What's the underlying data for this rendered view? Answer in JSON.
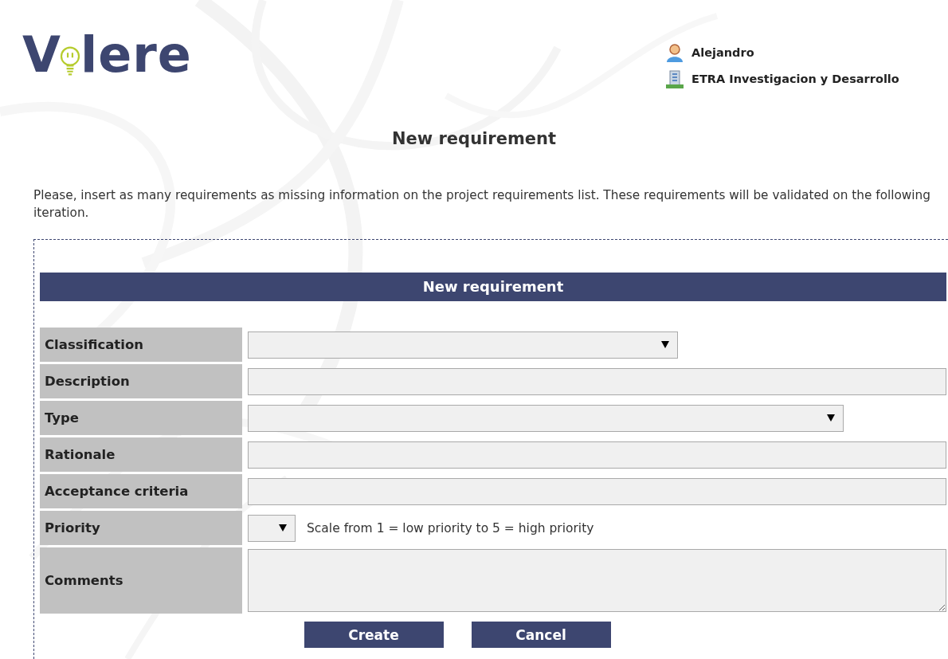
{
  "logo": {
    "before": "V",
    "after": "lere"
  },
  "user": {
    "name": "Alejandro",
    "organization": "ETRA Investigacion y Desarrollo"
  },
  "page_title": "New requirement",
  "intro": "Please, insert as many requirements as missing information on the project requirements list. These requirements will be validated on the following iteration.",
  "form": {
    "title": "New requirement",
    "fields": [
      {
        "label": "Classification",
        "kind": "select"
      },
      {
        "label": "Description",
        "kind": "text"
      },
      {
        "label": "Type",
        "kind": "select"
      },
      {
        "label": "Rationale",
        "kind": "text"
      },
      {
        "label": "Acceptance criteria",
        "kind": "text"
      },
      {
        "label": "Priority",
        "kind": "select",
        "note": "Scale from 1 = low priority to 5 = high priority"
      },
      {
        "label": "Comments",
        "kind": "textarea"
      }
    ],
    "buttons": [
      "Create",
      "Cancel"
    ]
  }
}
